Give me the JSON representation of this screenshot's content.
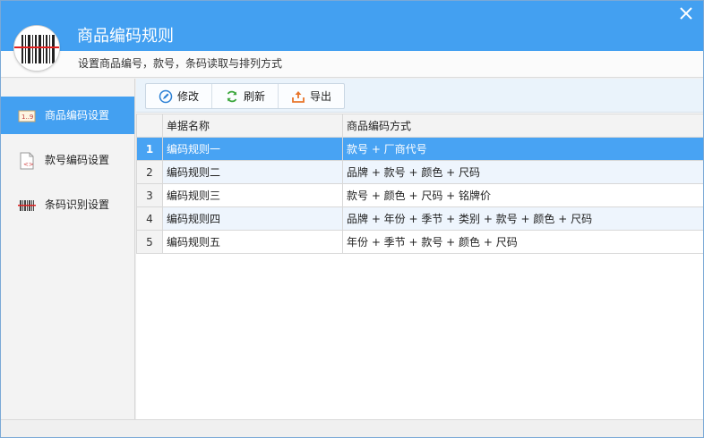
{
  "window": {
    "title": "商品编码规则",
    "subtitle": "设置商品编号，款号，条码读取与排列方式",
    "accent_color": "#43a0f1"
  },
  "sidebar": {
    "items": [
      {
        "label": "商品编码设置",
        "icon": "code-rule-icon",
        "active": true
      },
      {
        "label": "款号编码设置",
        "icon": "document-code-icon",
        "active": false
      },
      {
        "label": "条码识别设置",
        "icon": "barcode-icon",
        "active": false
      }
    ]
  },
  "toolbar": {
    "edit_label": "修改",
    "refresh_label": "刷新",
    "export_label": "导出"
  },
  "table": {
    "columns": [
      "",
      "单据名称",
      "商品编码方式"
    ],
    "rows": [
      {
        "index": "1",
        "name": "编码规则一",
        "method": "款号 + 厂商代号",
        "selected": true
      },
      {
        "index": "2",
        "name": "编码规则二",
        "method": "品牌 + 款号 + 颜色 + 尺码",
        "selected": false
      },
      {
        "index": "3",
        "name": "编码规则三",
        "method": "款号 + 颜色 + 尺码 + 铭牌价",
        "selected": false
      },
      {
        "index": "4",
        "name": "编码规则四",
        "method": "品牌 + 年份 + 季节 + 类别 + 款号 + 颜色 + 尺码",
        "selected": false
      },
      {
        "index": "5",
        "name": "编码规则五",
        "method": "年份 + 季节 + 款号 + 颜色 + 尺码",
        "selected": false
      }
    ]
  }
}
